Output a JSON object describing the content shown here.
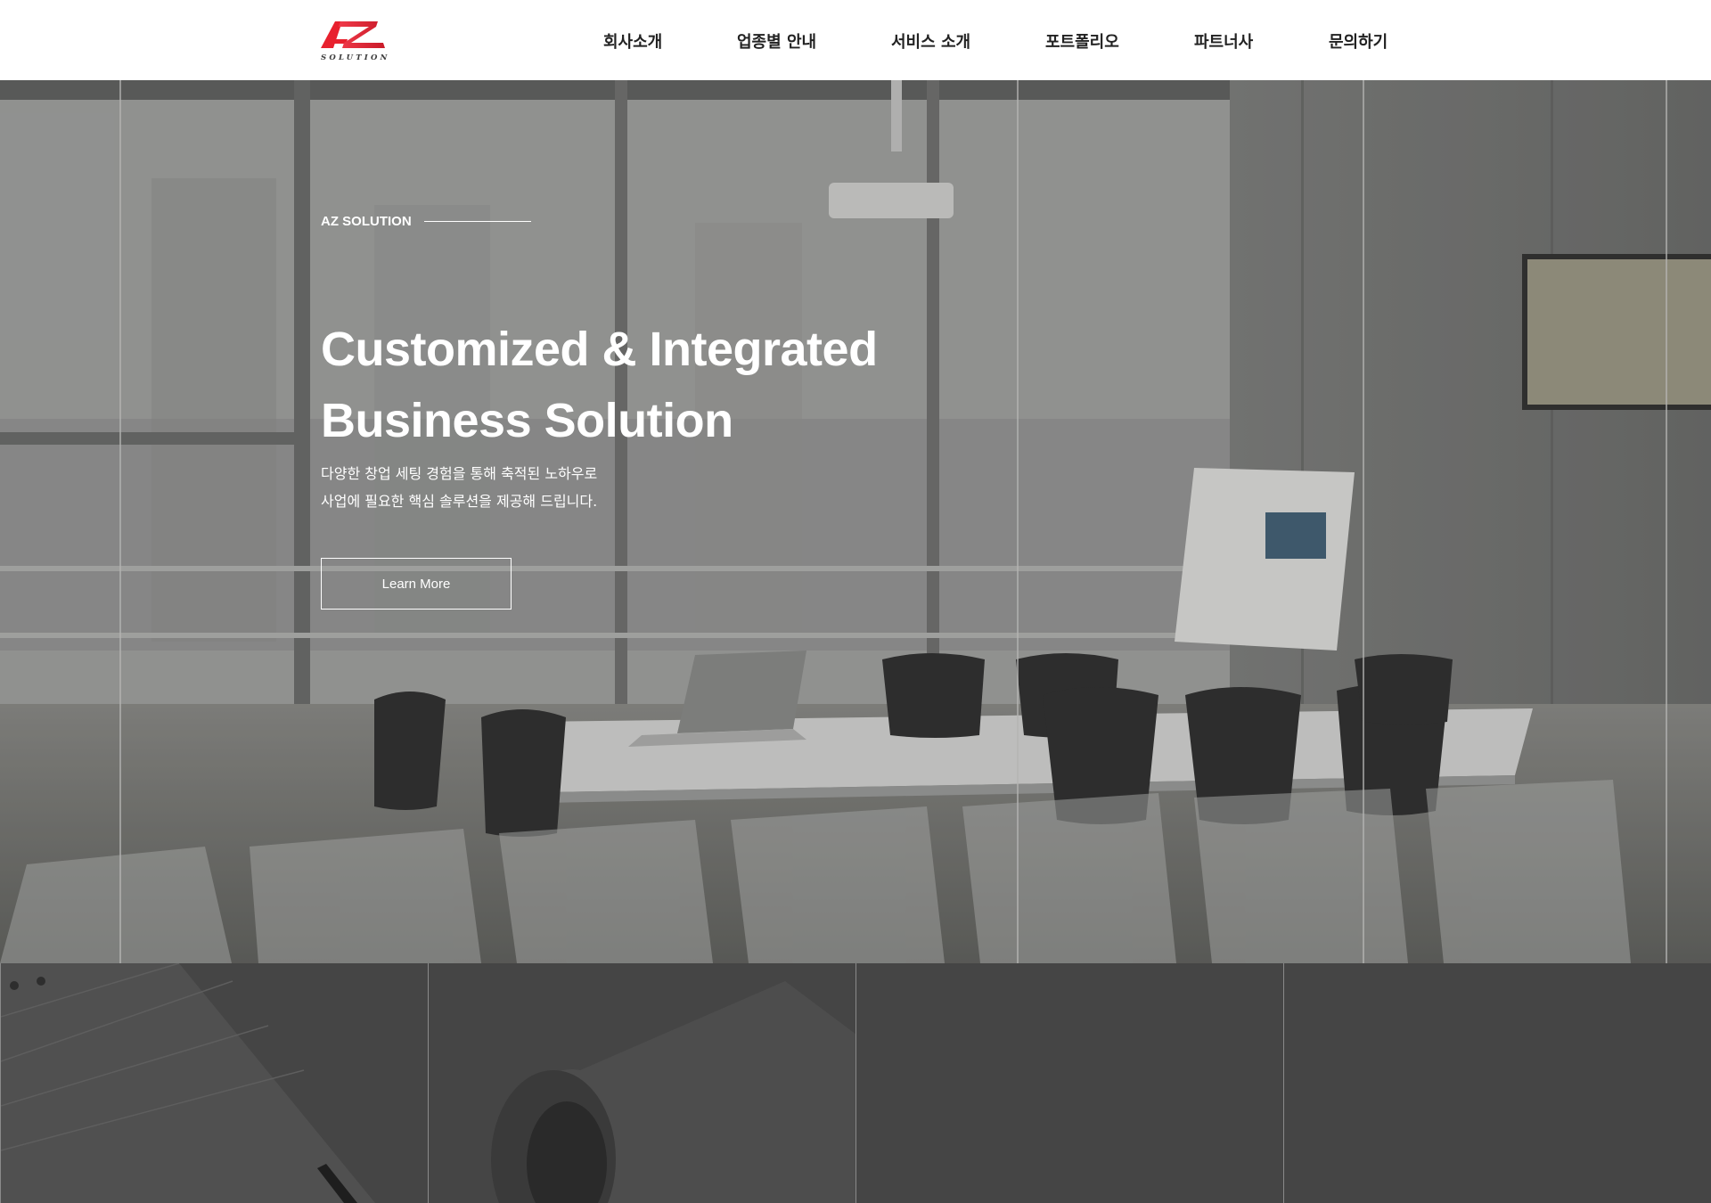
{
  "header": {
    "logo_text": "AZ",
    "logo_sub": "SOLUTION",
    "nav": [
      {
        "label": "회사소개"
      },
      {
        "label": "업종별 안내"
      },
      {
        "label": "서비스 소개"
      },
      {
        "label": "포트폴리오"
      },
      {
        "label": "파트너사"
      },
      {
        "label": "문의하기"
      }
    ]
  },
  "hero": {
    "eyebrow": "AZ SOLUTION",
    "title_line1": "Customized & Integrated",
    "title_line2": "Business Solution",
    "desc_line1": "다양한 창업 세팅 경험을 통해 축적된 노하우로",
    "desc_line2": "사업에 필요한 핵심 솔루션을 제공해 드립니다.",
    "button_label": "Learn More"
  },
  "tiles": [
    {
      "name": "tile-calendar"
    },
    {
      "name": "tile-paper-roll"
    },
    {
      "name": "tile-blank-3"
    },
    {
      "name": "tile-blank-4"
    }
  ],
  "colors": {
    "logo_red": "#e8212e",
    "header_bg": "#ffffff",
    "nav_text": "#222222",
    "tile_bg": "#454545"
  }
}
